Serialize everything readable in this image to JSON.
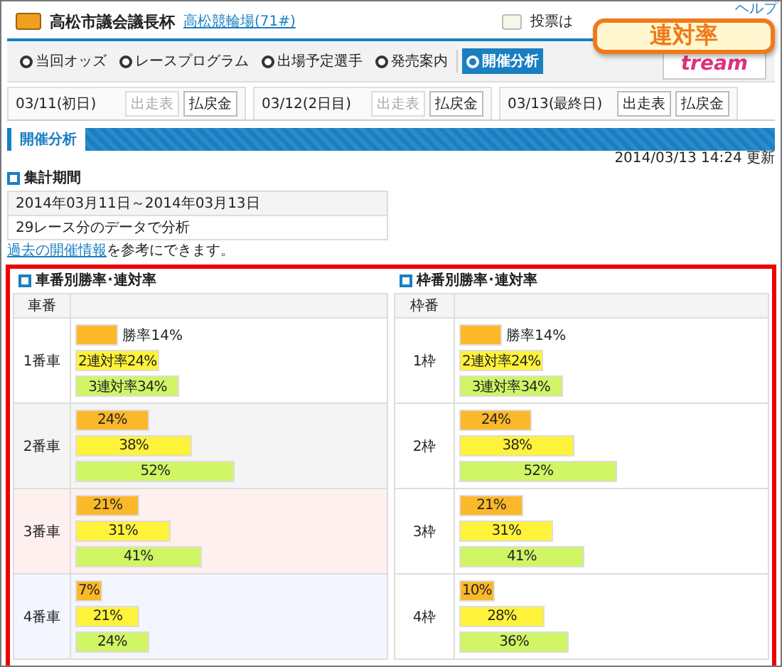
{
  "header": {
    "title": "高松市議会議長杯",
    "venue_link": "高松競輪場(71#)",
    "vote_note": "投票は",
    "help_link": "ヘルプ",
    "stream_logo": "tream"
  },
  "nav": [
    {
      "label": "当回オッズ",
      "selected": false
    },
    {
      "label": "レースプログラム",
      "selected": false
    },
    {
      "label": "出場予定選手",
      "selected": false
    },
    {
      "label": "発売案内",
      "selected": false
    },
    {
      "label": "開催分析",
      "selected": true
    }
  ],
  "days": [
    {
      "date": "03/11(初日)",
      "buttons": [
        {
          "label": "出走表",
          "disabled": true
        },
        {
          "label": "払戻金",
          "disabled": false
        }
      ]
    },
    {
      "date": "03/12(2日目)",
      "buttons": [
        {
          "label": "出走表",
          "disabled": true
        },
        {
          "label": "払戻金",
          "disabled": false
        }
      ]
    },
    {
      "date": "03/13(最終日)",
      "buttons": [
        {
          "label": "出走表",
          "disabled": false
        },
        {
          "label": "払戻金",
          "disabled": false
        }
      ]
    }
  ],
  "section_title": "開催分析",
  "updated": "2014/03/13 14:24 更新",
  "period": {
    "heading": "集計期間",
    "rows": [
      "2014年03月11日～2014年03月13日",
      "29レース分のデータで分析"
    ],
    "note_link": "過去の開催情報",
    "note_rest": "を参考にできます。"
  },
  "callout": {
    "text": "連対率"
  },
  "tables": [
    {
      "heading": "車番別勝率･連対率",
      "column_1": "車番",
      "rows": [
        {
          "label": "1番車",
          "color": "#ffffff",
          "bars": [
            {
              "kind": "win",
              "label": "勝率14%",
              "level": 0.14,
              "label_outside": true
            },
            {
              "kind": "exacta",
              "label": "2連対率24%",
              "level": 0.24,
              "label_outside": false
            },
            {
              "kind": "trifecta",
              "label": "3連対率34%",
              "level": 0.34,
              "label_outside": false
            }
          ]
        },
        {
          "label": "2番車",
          "color": "#f4f4f4",
          "bars": [
            {
              "kind": "win",
              "label": "24%",
              "level": 0.24,
              "label_outside": false
            },
            {
              "kind": "exacta",
              "label": "38%",
              "level": 0.38,
              "label_outside": false
            },
            {
              "kind": "trifecta",
              "label": "52%",
              "level": 0.52,
              "label_outside": false
            }
          ]
        },
        {
          "label": "3番車",
          "color": "#fff0f0",
          "bars": [
            {
              "kind": "win",
              "label": "21%",
              "level": 0.21,
              "label_outside": false
            },
            {
              "kind": "exacta",
              "label": "31%",
              "level": 0.31,
              "label_outside": false
            },
            {
              "kind": "trifecta",
              "label": "41%",
              "level": 0.41,
              "label_outside": false
            }
          ]
        },
        {
          "label": "4番車",
          "color": "#f3f6ff",
          "bars": [
            {
              "kind": "win",
              "label": "7%",
              "level": 0.07,
              "label_outside": false
            },
            {
              "kind": "exacta",
              "label": "21%",
              "level": 0.21,
              "label_outside": false
            },
            {
              "kind": "trifecta",
              "label": "24%",
              "level": 0.24,
              "label_outside": false
            }
          ]
        }
      ]
    },
    {
      "heading": "枠番別勝率･連対率",
      "column_1": "枠番",
      "rows": [
        {
          "label": "1枠",
          "bars": [
            {
              "kind": "win",
              "label": "勝率14%",
              "level": 0.14,
              "label_outside": true
            },
            {
              "kind": "exacta",
              "label": "2連対率24%",
              "level": 0.24,
              "label_outside": false
            },
            {
              "kind": "trifecta",
              "label": "3連対率34%",
              "level": 0.34,
              "label_outside": false
            }
          ]
        },
        {
          "label": "2枠",
          "bars": [
            {
              "kind": "win",
              "label": "24%",
              "level": 0.24,
              "label_outside": false
            },
            {
              "kind": "exacta",
              "label": "38%",
              "level": 0.38,
              "label_outside": false
            },
            {
              "kind": "trifecta",
              "label": "52%",
              "level": 0.52,
              "label_outside": false
            }
          ]
        },
        {
          "label": "3枠",
          "bars": [
            {
              "kind": "win",
              "label": "21%",
              "level": 0.21,
              "label_outside": false
            },
            {
              "kind": "exacta",
              "label": "31%",
              "level": 0.31,
              "label_outside": false
            },
            {
              "kind": "trifecta",
              "label": "41%",
              "level": 0.41,
              "label_outside": false
            }
          ]
        },
        {
          "label": "4枠",
          "bars": [
            {
              "kind": "win",
              "label": "10%",
              "level": 0.1,
              "label_outside": false
            },
            {
              "kind": "exacta",
              "label": "28%",
              "level": 0.28,
              "label_outside": false
            },
            {
              "kind": "trifecta",
              "label": "36%",
              "level": 0.36,
              "label_outside": false
            }
          ]
        }
      ]
    }
  ]
}
